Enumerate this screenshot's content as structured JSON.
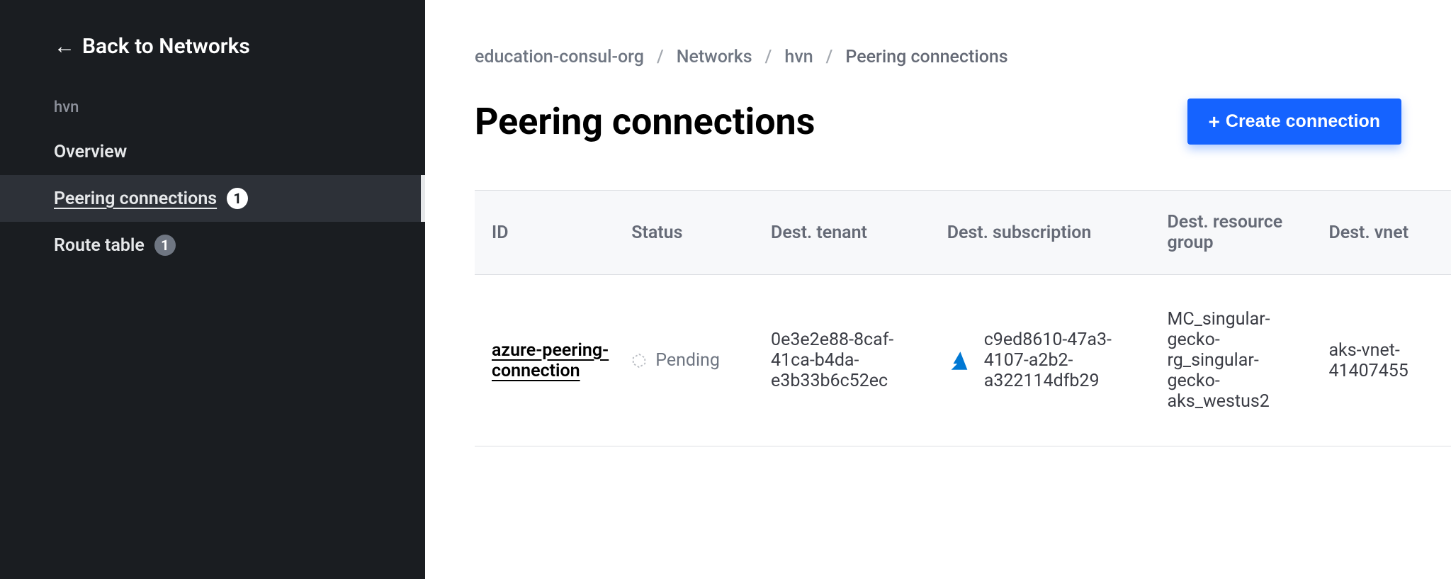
{
  "sidebar": {
    "back_label": "Back to Networks",
    "context": "hvn",
    "items": [
      {
        "label": "Overview",
        "active": false,
        "badge": null
      },
      {
        "label": "Peering connections",
        "active": true,
        "badge": "1",
        "badge_muted": false
      },
      {
        "label": "Route table",
        "active": false,
        "badge": "1",
        "badge_muted": true
      }
    ]
  },
  "breadcrumb": {
    "items": [
      {
        "label": "education-consul-org"
      },
      {
        "label": "Networks"
      },
      {
        "label": "hvn"
      },
      {
        "label": "Peering connections",
        "current": true
      }
    ]
  },
  "header": {
    "title": "Peering connections",
    "create_label": "Create connection"
  },
  "table": {
    "columns": [
      "ID",
      "Status",
      "Dest. tenant",
      "Dest. subscription",
      "Dest. resource group",
      "Dest. vnet"
    ],
    "rows": [
      {
        "id": "azure-peering-connection",
        "status": "Pending",
        "dest_tenant": "0e3e2e88-8caf-41ca-b4da-e3b33b6c52ec",
        "dest_subscription": "c9ed8610-47a3-4107-a2b2-a322114dfb29",
        "dest_resource_group": "MC_singular-gecko-rg_singular-gecko-aks_westus2",
        "dest_vnet": "aks-vnet-41407455"
      }
    ]
  },
  "icons": {
    "arrow_left": "arrow-left-icon",
    "plus": "plus-icon",
    "pending": "pending-icon",
    "azure": "azure-icon"
  }
}
